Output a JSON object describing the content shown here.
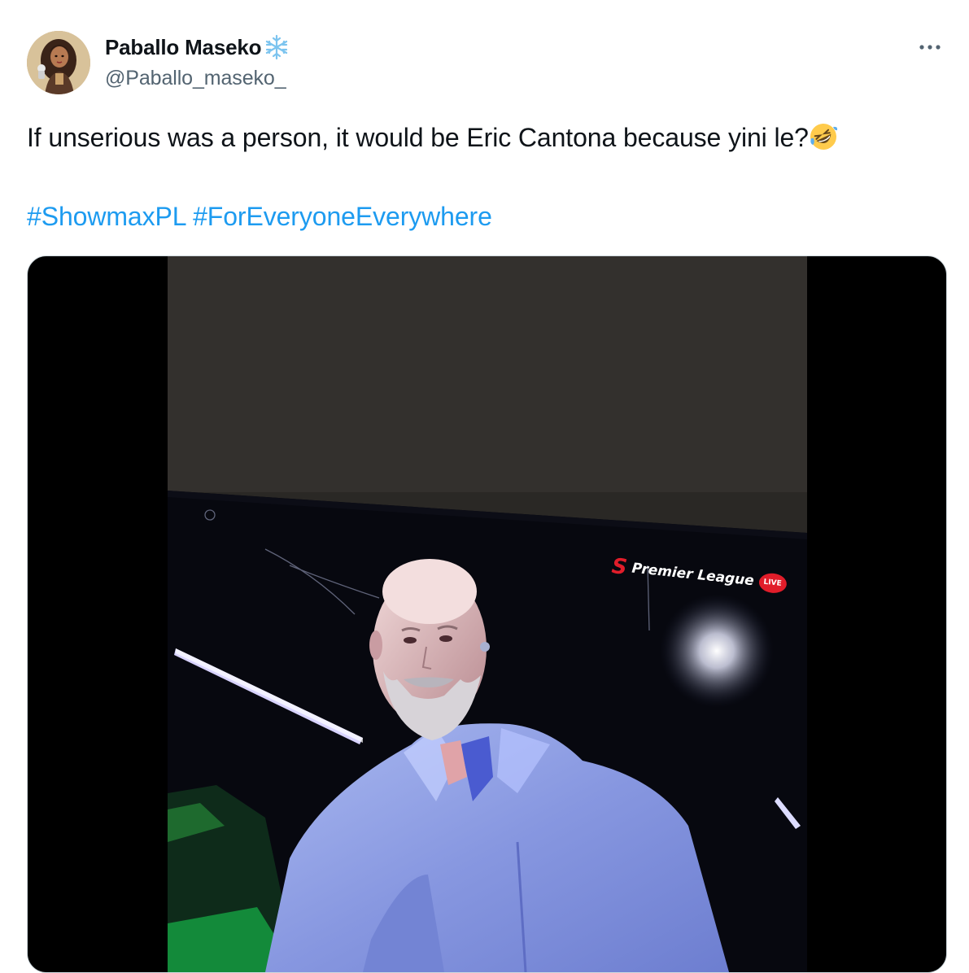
{
  "author": {
    "display_name": "Paballo Maseko",
    "badge_icon": "snowflake-icon",
    "handle": "@Paballo_maseko_"
  },
  "tweet": {
    "text": "If unserious was a person, it would be Eric Cantona because yini le?",
    "emoji": "rolling-on-floor-laughing-emoji",
    "hashtags": [
      "#ShowmaxPL",
      "#ForEveryoneEverywhere"
    ]
  },
  "media": {
    "overlay_brand_text": "Premier League",
    "overlay_logo_text": "S",
    "overlay_live_text": "LIVE"
  },
  "colors": {
    "link": "#1d9bf0",
    "handle": "#536471",
    "text": "#0f1419",
    "live_red": "#e11d2a"
  }
}
